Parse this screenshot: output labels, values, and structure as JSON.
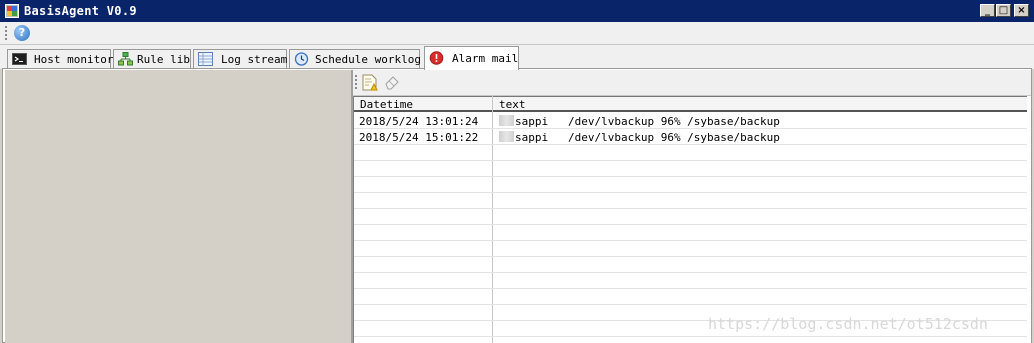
{
  "window": {
    "title": "BasisAgent V0.9",
    "minimize_glyph": "_",
    "maximize_glyph": "□",
    "close_glyph": "×"
  },
  "toolbar": {
    "help_glyph": "?"
  },
  "tabs": [
    {
      "label": "Host monitor",
      "icon": "terminal-icon",
      "active": false
    },
    {
      "label": "Rule lib",
      "icon": "hierarchy-icon",
      "active": false
    },
    {
      "label": "Log stream",
      "icon": "log-table-icon",
      "active": false
    },
    {
      "label": "Schedule worklog",
      "icon": "clock-icon",
      "active": false
    },
    {
      "label": "Alarm mail",
      "icon": "alert-icon",
      "active": true
    }
  ],
  "alarm_toolbar": {
    "tools": [
      "report-warning-icon",
      "eraser-icon"
    ]
  },
  "grid": {
    "columns": [
      "Datetime",
      "text"
    ],
    "rows": [
      {
        "datetime": "2018/5/24 13:01:24",
        "text": "sappi   /dev/lvbackup 96% /sybase/backup"
      },
      {
        "datetime": "2018/5/24 15:01:22",
        "text": "sappi   /dev/lvbackup 96% /sybase/backup"
      }
    ]
  },
  "watermark": "https://blog.csdn.net/ot512csdn",
  "colors": {
    "titlebar": "#0a246a",
    "window_bg": "#d4d0c8",
    "alert_red": "#d92b2b"
  }
}
